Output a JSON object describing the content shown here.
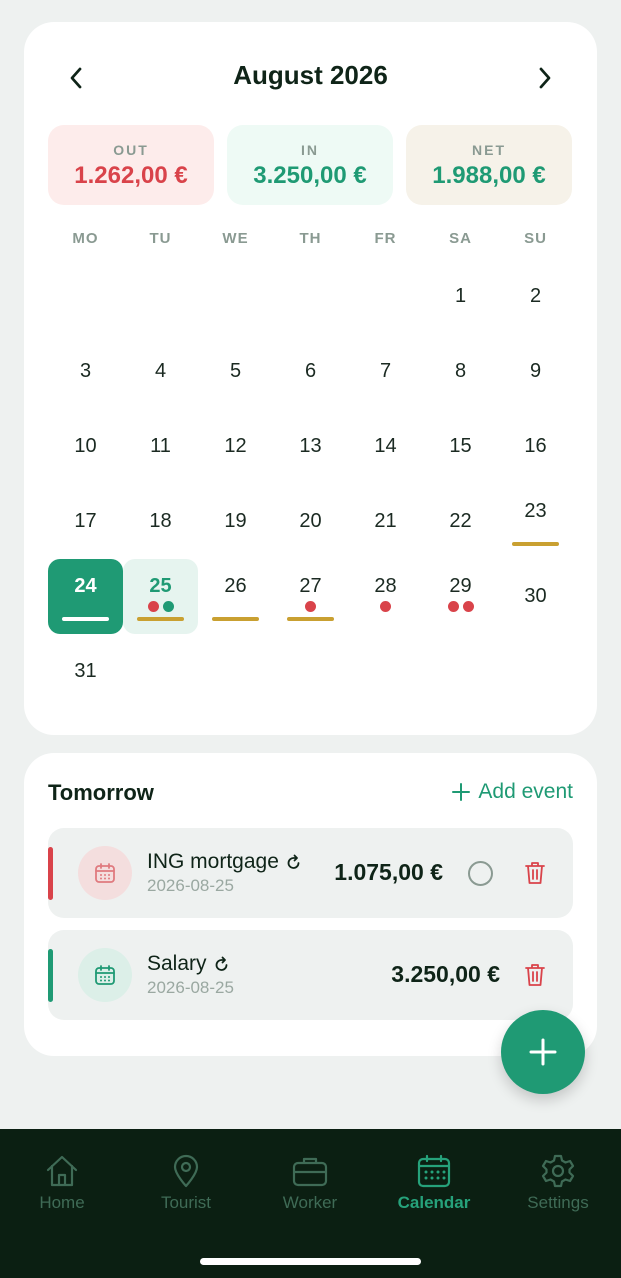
{
  "calendar": {
    "month_title": "August 2026",
    "summary": {
      "out": {
        "label": "OUT",
        "value": "1.262,00 €"
      },
      "in": {
        "label": "IN",
        "value": "3.250,00 €"
      },
      "net": {
        "label": "NET",
        "value": "1.988,00 €"
      }
    },
    "weekdays": [
      "MO",
      "TU",
      "WE",
      "TH",
      "FR",
      "SA",
      "SU"
    ],
    "leading_blanks": 5,
    "days": [
      {
        "n": "1"
      },
      {
        "n": "2"
      },
      {
        "n": "3"
      },
      {
        "n": "4"
      },
      {
        "n": "5"
      },
      {
        "n": "6"
      },
      {
        "n": "7"
      },
      {
        "n": "8"
      },
      {
        "n": "9"
      },
      {
        "n": "10"
      },
      {
        "n": "11"
      },
      {
        "n": "12"
      },
      {
        "n": "13"
      },
      {
        "n": "14"
      },
      {
        "n": "15"
      },
      {
        "n": "16"
      },
      {
        "n": "17"
      },
      {
        "n": "18"
      },
      {
        "n": "19"
      },
      {
        "n": "20"
      },
      {
        "n": "21"
      },
      {
        "n": "22"
      },
      {
        "n": "23",
        "underline": true
      },
      {
        "n": "24",
        "today": true,
        "underline": true
      },
      {
        "n": "25",
        "selected": true,
        "underline": true,
        "dots": [
          "red",
          "green"
        ]
      },
      {
        "n": "26",
        "underline": true
      },
      {
        "n": "27",
        "underline": true,
        "dots": [
          "red"
        ]
      },
      {
        "n": "28",
        "dots": [
          "red"
        ]
      },
      {
        "n": "29",
        "dots": [
          "red",
          "red"
        ]
      },
      {
        "n": "30"
      },
      {
        "n": "31"
      }
    ]
  },
  "events": {
    "title": "Tomorrow",
    "add_label": "Add event",
    "items": [
      {
        "name": "ING mortgage",
        "date": "2026-08-25",
        "amount": "1.075,00 €",
        "type": "out"
      },
      {
        "name": "Salary",
        "date": "2026-08-25",
        "amount": "3.250,00 €",
        "type": "in"
      }
    ]
  },
  "tabs": [
    {
      "label": "Home",
      "icon": "home-icon"
    },
    {
      "label": "Tourist",
      "icon": "location-pin-icon"
    },
    {
      "label": "Worker",
      "icon": "briefcase-icon"
    },
    {
      "label": "Calendar",
      "icon": "calendar-icon",
      "active": true
    },
    {
      "label": "Settings",
      "icon": "gear-icon"
    }
  ],
  "colors": {
    "accent": "#1f9a74",
    "out": "#d9434a",
    "underline": "#c9a031",
    "tabbar": "#0b1f12"
  }
}
